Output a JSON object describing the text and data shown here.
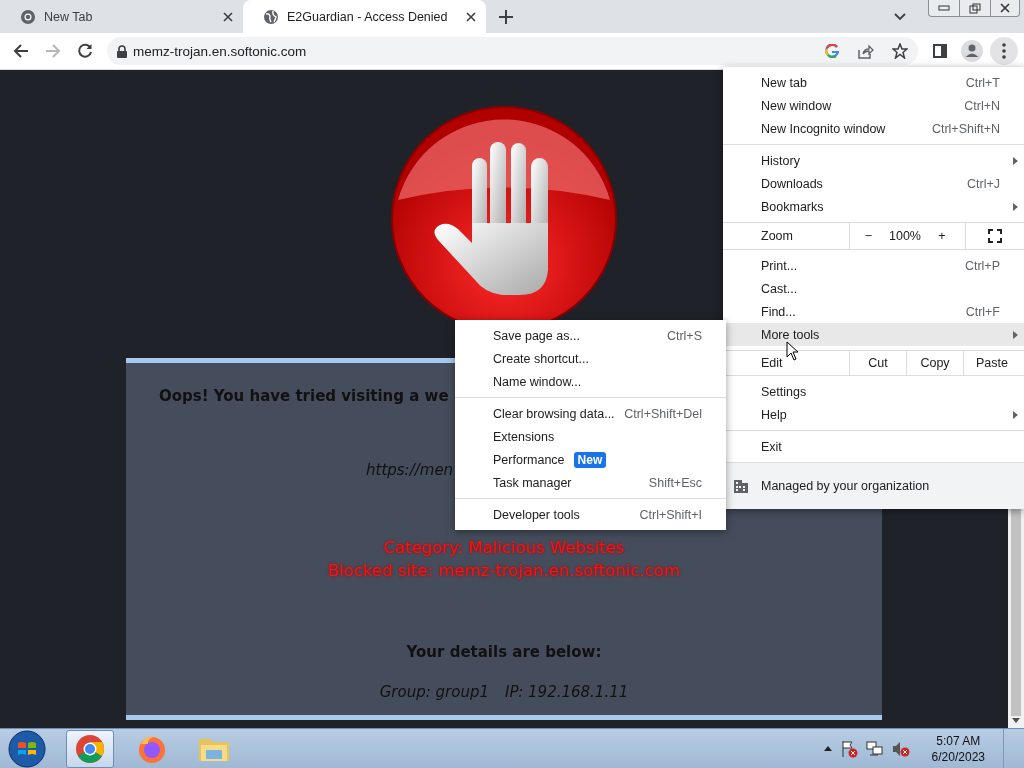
{
  "tabs": [
    {
      "title": "New Tab",
      "selected": false
    },
    {
      "title": "E2Guardian - Access Denied",
      "selected": true
    }
  ],
  "toolbar": {
    "url": "memz-trojan.en.softonic.com",
    "forward_disabled": true
  },
  "page": {
    "heading": "Oops! You have tried visiting a we",
    "url": "https://men",
    "category": "Category: Malicious Websites",
    "blocked": "Blocked site: memz-trojan.en.softonic.com",
    "details_heading": "Your details are below:",
    "group": "Group: group1",
    "ip": "IP: 192.168.1.11"
  },
  "menu": {
    "groups": [
      [
        {
          "kind": "item",
          "label": "New tab",
          "shortcut": "Ctrl+T",
          "submenu": false,
          "selected": false
        },
        {
          "kind": "item",
          "label": "New window",
          "shortcut": "Ctrl+N",
          "submenu": false,
          "selected": false
        },
        {
          "kind": "item",
          "label": "New Incognito window",
          "shortcut": "Ctrl+Shift+N",
          "submenu": false,
          "selected": false
        }
      ],
      [
        {
          "kind": "item",
          "label": "History",
          "submenu": true,
          "selected": false
        },
        {
          "kind": "item",
          "label": "Downloads",
          "shortcut": "Ctrl+J",
          "submenu": false,
          "selected": false
        },
        {
          "kind": "item",
          "label": "Bookmarks",
          "submenu": true,
          "selected": false
        }
      ],
      [
        {
          "kind": "zoom",
          "label": "Zoom",
          "minus": "−",
          "value": "100%",
          "plus": "+"
        }
      ],
      [
        {
          "kind": "item",
          "label": "Print...",
          "shortcut": "Ctrl+P",
          "submenu": false,
          "selected": false
        },
        {
          "kind": "item",
          "label": "Cast...",
          "submenu": false,
          "selected": false
        },
        {
          "kind": "item",
          "label": "Find...",
          "shortcut": "Ctrl+F",
          "submenu": false,
          "selected": false
        },
        {
          "kind": "item",
          "label": "More tools",
          "submenu": true,
          "selected": true
        }
      ],
      [
        {
          "kind": "edit",
          "label": "Edit",
          "actions": [
            "Cut",
            "Copy",
            "Paste"
          ]
        }
      ],
      [
        {
          "kind": "item",
          "label": "Settings",
          "submenu": false,
          "selected": false
        },
        {
          "kind": "item",
          "label": "Help",
          "submenu": true,
          "selected": false
        }
      ],
      [
        {
          "kind": "item",
          "label": "Exit",
          "submenu": false,
          "selected": false
        }
      ],
      [
        {
          "kind": "managed",
          "label": "Managed by your organization"
        }
      ]
    ]
  },
  "submenu": {
    "groups": [
      [
        {
          "kind": "item",
          "label": "Save page as...",
          "shortcut": "Ctrl+S",
          "submenu": false,
          "selected": false
        },
        {
          "kind": "item",
          "label": "Create shortcut...",
          "submenu": false,
          "selected": false
        },
        {
          "kind": "item",
          "label": "Name window...",
          "submenu": false,
          "selected": false
        }
      ],
      [
        {
          "kind": "item",
          "label": "Clear browsing data...",
          "shortcut": "Ctrl+Shift+Del",
          "submenu": false,
          "selected": false
        },
        {
          "kind": "item",
          "label": "Extensions",
          "submenu": false,
          "selected": false
        },
        {
          "kind": "item",
          "label": "Performance",
          "badge": "New",
          "submenu": false,
          "selected": false
        },
        {
          "kind": "item",
          "label": "Task manager",
          "shortcut": "Shift+Esc",
          "submenu": false,
          "selected": false
        }
      ],
      [
        {
          "kind": "item",
          "label": "Developer tools",
          "shortcut": "Ctrl+Shift+I",
          "submenu": false,
          "selected": false
        }
      ]
    ]
  },
  "taskbar": {
    "apps": [
      {
        "kind": "chrome",
        "active": true
      },
      {
        "kind": "firefox",
        "active": false
      },
      {
        "kind": "explorer",
        "active": false
      }
    ],
    "time": "5:07 AM",
    "date": "6/20/2023"
  }
}
